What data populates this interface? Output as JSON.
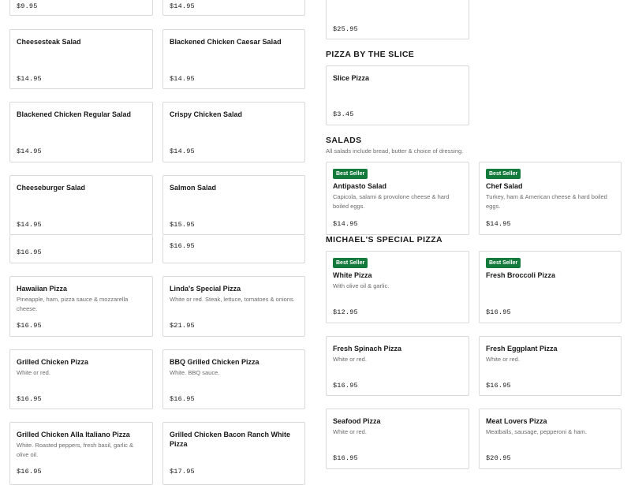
{
  "left_cards": [
    {
      "name": "",
      "desc": "",
      "price": "$9.95",
      "badge": ""
    },
    {
      "name": "",
      "desc": "",
      "price": "$14.95",
      "badge": ""
    },
    {
      "name": "Cheesesteak Salad",
      "desc": "",
      "price": "$14.95",
      "badge": ""
    },
    {
      "name": "Blackened Chicken Caesar Salad",
      "desc": "",
      "price": "$14.95",
      "badge": ""
    },
    {
      "name": "Blackened Chicken Regular Salad",
      "desc": "",
      "price": "$14.95",
      "badge": ""
    },
    {
      "name": "Crispy Chicken Salad",
      "desc": "",
      "price": "$14.95",
      "badge": ""
    },
    {
      "name": "Cheeseburger Salad",
      "desc": "",
      "price": "$14.95",
      "badge": ""
    },
    {
      "name": "Salmon Salad",
      "desc": "",
      "price": "$15.95",
      "badge": ""
    },
    {
      "name": "",
      "desc": "",
      "price": "$16.95",
      "badge": ""
    },
    {
      "name": "",
      "desc": "",
      "price": "$16.95",
      "badge": ""
    },
    {
      "name": "Hawaiian Pizza",
      "desc": "Pineapple, ham, pizza sauce & mozzarella cheese.",
      "price": "$16.95",
      "badge": ""
    },
    {
      "name": "Linda's Special Pizza",
      "desc": "White or red. Steak, lettuce, tomatoes & onions.",
      "price": "$21.95",
      "badge": ""
    },
    {
      "name": "Grilled Chicken Pizza",
      "desc": "White or red.",
      "price": "$16.95",
      "badge": ""
    },
    {
      "name": "BBQ Grilled Chicken Pizza",
      "desc": "White. BBQ sauce.",
      "price": "$16.95",
      "badge": ""
    },
    {
      "name": "Grilled Chicken Alla Italiano Pizza",
      "desc": "White. Roasted peppers, fresh basil, garlic & olive oil.",
      "price": "$16.95",
      "badge": ""
    },
    {
      "name": "Grilled Chicken Bacon Ranch White Pizza",
      "desc": "",
      "price": "$17.95",
      "badge": ""
    }
  ],
  "right_top_card": {
    "price": "$25.95"
  },
  "sections": {
    "slice": {
      "title": "PIZZA BY THE SLICE"
    },
    "salads": {
      "title": "SALADS",
      "subtitle": "All salads include bread, butter & choice of dressing."
    },
    "special": {
      "title": "MICHAEL'S SPECIAL PIZZA"
    }
  },
  "right_cards": [
    {
      "name": "Slice Pizza",
      "desc": "",
      "price": "$3.45",
      "badge": ""
    },
    {
      "name": "Antipasto Salad",
      "desc": "Capicola, salami & provolone cheese & hard boiled eggs.",
      "price": "$14.95",
      "badge": "Best Seller"
    },
    {
      "name": "Chef Salad",
      "desc": "Turkey, ham & American cheese & hard boiled eggs.",
      "price": "$14.95",
      "badge": "Best Seller"
    },
    {
      "name": "White Pizza",
      "desc": "With olive oil & garlic.",
      "price": "$12.95",
      "badge": "Best Seller"
    },
    {
      "name": "Fresh Broccoli Pizza",
      "desc": "",
      "price": "$16.95",
      "badge": "Best Seller"
    },
    {
      "name": "Fresh Spinach Pizza",
      "desc": "White or red.",
      "price": "$16.95",
      "badge": ""
    },
    {
      "name": "Fresh Eggplant Pizza",
      "desc": "White or red.",
      "price": "$16.95",
      "badge": ""
    },
    {
      "name": "Seafood Pizza",
      "desc": "White or red.",
      "price": "$16.95",
      "badge": ""
    },
    {
      "name": "Meat Lovers Pizza",
      "desc": "Meatballs, sausage, pepperoni & ham.",
      "price": "$20.95",
      "badge": ""
    }
  ]
}
